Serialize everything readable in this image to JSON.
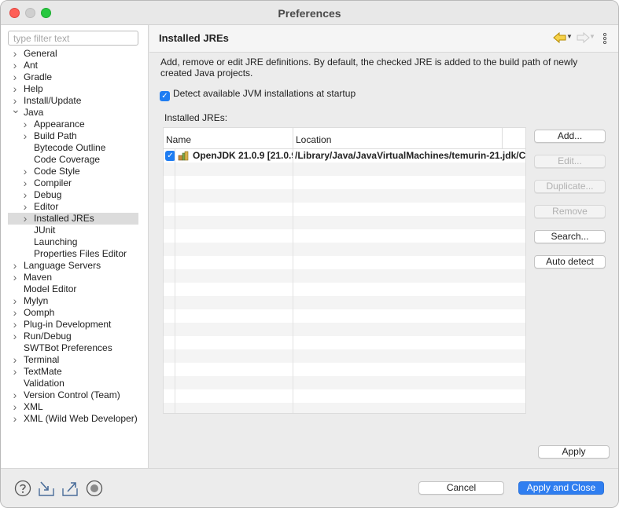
{
  "window": {
    "title": "Preferences"
  },
  "filter": {
    "placeholder": "type filter text"
  },
  "tree": [
    {
      "label": "General",
      "level": 0,
      "expander": "closed"
    },
    {
      "label": "Ant",
      "level": 0,
      "expander": "closed"
    },
    {
      "label": "Gradle",
      "level": 0,
      "expander": "closed"
    },
    {
      "label": "Help",
      "level": 0,
      "expander": "closed"
    },
    {
      "label": "Install/Update",
      "level": 0,
      "expander": "closed"
    },
    {
      "label": "Java",
      "level": 0,
      "expander": "open"
    },
    {
      "label": "Appearance",
      "level": 1,
      "expander": "closed"
    },
    {
      "label": "Build Path",
      "level": 1,
      "expander": "closed"
    },
    {
      "label": "Bytecode Outline",
      "level": 1,
      "expander": "none"
    },
    {
      "label": "Code Coverage",
      "level": 1,
      "expander": "none"
    },
    {
      "label": "Code Style",
      "level": 1,
      "expander": "closed"
    },
    {
      "label": "Compiler",
      "level": 1,
      "expander": "closed"
    },
    {
      "label": "Debug",
      "level": 1,
      "expander": "closed"
    },
    {
      "label": "Editor",
      "level": 1,
      "expander": "closed"
    },
    {
      "label": "Installed JREs",
      "level": 1,
      "expander": "closed",
      "selected": true
    },
    {
      "label": "JUnit",
      "level": 1,
      "expander": "none"
    },
    {
      "label": "Launching",
      "level": 1,
      "expander": "none"
    },
    {
      "label": "Properties Files Editor",
      "level": 1,
      "expander": "none"
    },
    {
      "label": "Language Servers",
      "level": 0,
      "expander": "closed"
    },
    {
      "label": "Maven",
      "level": 0,
      "expander": "closed"
    },
    {
      "label": "Model Editor",
      "level": 0,
      "expander": "none"
    },
    {
      "label": "Mylyn",
      "level": 0,
      "expander": "closed"
    },
    {
      "label": "Oomph",
      "level": 0,
      "expander": "closed"
    },
    {
      "label": "Plug-in Development",
      "level": 0,
      "expander": "closed"
    },
    {
      "label": "Run/Debug",
      "level": 0,
      "expander": "closed"
    },
    {
      "label": "SWTBot Preferences",
      "level": 0,
      "expander": "none"
    },
    {
      "label": "Terminal",
      "level": 0,
      "expander": "closed"
    },
    {
      "label": "TextMate",
      "level": 0,
      "expander": "closed"
    },
    {
      "label": "Validation",
      "level": 0,
      "expander": "none"
    },
    {
      "label": "Version Control (Team)",
      "level": 0,
      "expander": "closed"
    },
    {
      "label": "XML",
      "level": 0,
      "expander": "closed"
    },
    {
      "label": "XML (Wild Web Developer)",
      "level": 0,
      "expander": "closed"
    }
  ],
  "page": {
    "title": "Installed JREs",
    "description": "Add, remove or edit JRE definitions. By default, the checked JRE is added to the build path of newly created Java projects.",
    "detect_label": "Detect available JVM installations at startup",
    "detect_checked": true,
    "table_label": "Installed JREs:",
    "columns": {
      "name": "Name",
      "location": "Location"
    },
    "rows": [
      {
        "checked": true,
        "name": "OpenJDK 21.0.9 [21.0.9",
        "location": "/Library/Java/JavaVirtualMachines/temurin-21.jdk/Co"
      }
    ],
    "empty_rows": 19
  },
  "buttons": {
    "add": "Add...",
    "edit": "Edit...",
    "duplicate": "Duplicate...",
    "remove": "Remove",
    "search": "Search...",
    "auto_detect": "Auto detect",
    "apply": "Apply",
    "cancel": "Cancel",
    "apply_close": "Apply and Close"
  },
  "colors": {
    "accent": "#2f7ef0",
    "selection": "#dcdcdc",
    "back_arrow": "#f0c000",
    "close": "#fe5f57",
    "maximize": "#28c840"
  },
  "icons": {
    "back": "arrow-left-icon",
    "forward": "arrow-right-icon",
    "menu": "kebab-menu-icon",
    "help": "help-icon",
    "import": "import-icon",
    "export": "export-icon",
    "record": "record-icon",
    "jre": "jre-library-icon"
  }
}
